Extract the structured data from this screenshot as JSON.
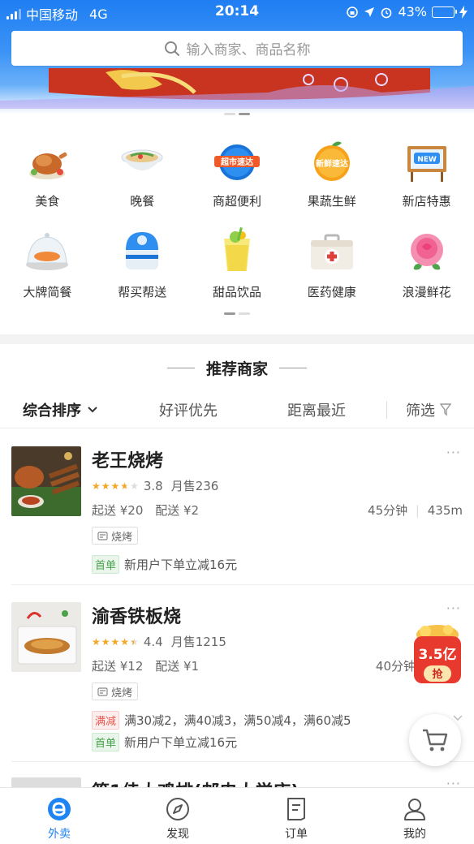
{
  "status_bar": {
    "carrier": "中国移动",
    "network": "4G",
    "time": "20:14",
    "battery": "43%"
  },
  "search": {
    "placeholder": "输入商家、商品名称"
  },
  "categories": [
    {
      "label": "美食",
      "icon": "roast-chicken-icon"
    },
    {
      "label": "晚餐",
      "icon": "noodle-bowl-icon"
    },
    {
      "label": "商超便利",
      "icon": "supermarket-express-icon"
    },
    {
      "label": "果蔬生鲜",
      "icon": "fresh-fruit-express-icon"
    },
    {
      "label": "新店特惠",
      "icon": "new-store-sign-icon"
    },
    {
      "label": "大牌简餐",
      "icon": "covered-dish-icon"
    },
    {
      "label": "帮买帮送",
      "icon": "delivery-box-icon"
    },
    {
      "label": "甜品饮品",
      "icon": "lemon-drink-icon"
    },
    {
      "label": "医药健康",
      "icon": "medicine-kit-icon"
    },
    {
      "label": "浪漫鲜花",
      "icon": "rose-flower-icon"
    }
  ],
  "category_logo_text": {
    "supermarket": "超市速达",
    "fruit": "新鲜速达",
    "new_store": "NEW"
  },
  "recommend": {
    "title": "推荐商家"
  },
  "sort": {
    "composite": "综合排序",
    "rating": "好评优先",
    "distance": "距离最近",
    "filter": "筛选"
  },
  "shops": [
    {
      "name": "老王烧烤",
      "stars": 3.8,
      "rating": "3.8",
      "monthly_sales": "月售236",
      "min_order": "起送 ¥20",
      "delivery_fee": "配送 ¥2",
      "time": "45分钟",
      "distance": "435m",
      "tag": "烧烤",
      "new_user_badge": "首单",
      "new_user_promo": "新用户下单立减16元"
    },
    {
      "name": "渝香铁板烧",
      "stars": 4.4,
      "rating": "4.4",
      "monthly_sales": "月售1215",
      "min_order": "起送 ¥12",
      "delivery_fee": "配送 ¥1",
      "time": "40分钟",
      "tag": "烧烤",
      "discount_badge": "满减",
      "discount_text": "满30减2，满40减3，满50减4，满60减5",
      "new_user_badge": "首单",
      "new_user_promo": "新用户下单立减16元"
    },
    {
      "name": "第1佳大鸡排(邮电大学店)"
    }
  ],
  "floating_promo": {
    "amount": "3.5亿",
    "action": "抢"
  },
  "tabs": [
    {
      "label": "外卖",
      "icon": "takeout-e-icon",
      "active": true
    },
    {
      "label": "发现",
      "icon": "compass-icon",
      "active": false
    },
    {
      "label": "订单",
      "icon": "order-list-icon",
      "active": false
    },
    {
      "label": "我的",
      "icon": "profile-icon",
      "active": false
    }
  ],
  "colors": {
    "brand_blue": "#1f84f3",
    "star": "#f6a623",
    "new_green": "#48a14d",
    "discount_red": "#e8574f"
  }
}
